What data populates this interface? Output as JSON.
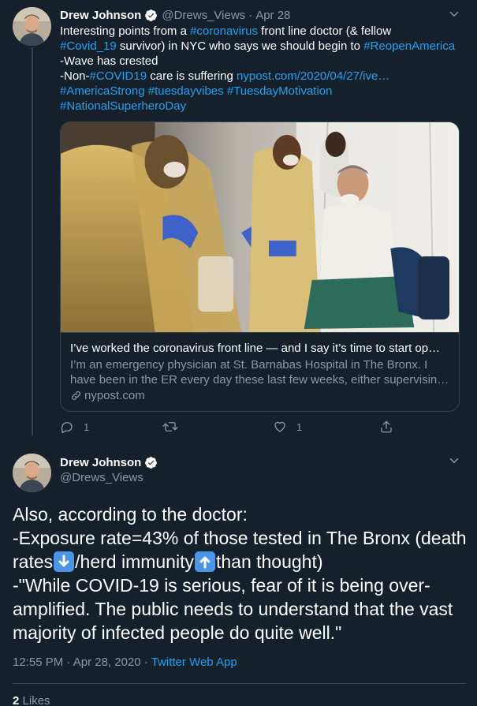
{
  "colors": {
    "background": "#15202b",
    "link": "#1da1f2",
    "muted": "#8899a6",
    "border": "#38444d",
    "emoji_blue": "#4a95e6"
  },
  "tweet1": {
    "author_name": "Drew Johnson",
    "handle": "@Drews_Views",
    "separator": "·",
    "date": "Apr 28",
    "verified_icon": "verified-badge-icon",
    "lines": [
      [
        {
          "text": "Interesting points from a ",
          "link": false
        },
        {
          "text": "#coronavirus",
          "link": true
        },
        {
          "text": " front line doctor (& fellow",
          "link": false
        }
      ],
      [
        {
          "text": "#Covid_19",
          "link": true
        },
        {
          "text": " survivor) in NYC who says we should begin to ",
          "link": false
        },
        {
          "text": "#ReopenAmerica",
          "link": true
        }
      ],
      [
        {
          "text": "-Wave has crested",
          "link": false
        }
      ],
      [
        {
          "text": "-Non-",
          "link": false
        },
        {
          "text": "#COVID19",
          "link": true
        },
        {
          "text": " care is suffering ",
          "link": false
        },
        {
          "text": "nypost.com/2020/04/27/ive…",
          "link": true
        }
      ],
      [
        {
          "text": "#AmericaStrong",
          "link": true
        },
        {
          "text": " ",
          "link": false
        },
        {
          "text": "#tuesdayvibes",
          "link": true
        },
        {
          "text": " ",
          "link": false
        },
        {
          "text": "#TuesdayMotivation",
          "link": true
        }
      ],
      [
        {
          "text": "#NationalSuperheroDay",
          "link": true
        }
      ]
    ],
    "card": {
      "title": "I’ve worked the coronavirus front line — and I say it’s time to start op…",
      "description_lines": [
        "I’m an emergency physician at St. Barnabas Hospital in The Bronx. I",
        "have been in the ER every day these last few weeks, either supervisin…"
      ],
      "domain": "nypost.com",
      "image_alt": "Medical workers in protective gear at a testing tent"
    },
    "actions": {
      "reply_count": "1",
      "retweet_count": "",
      "like_count": "1"
    }
  },
  "tweet2": {
    "author_name": "Drew Johnson",
    "handle": "@Drews_Views",
    "text_lines": [
      [
        {
          "text": "Also, according to the doctor:"
        }
      ],
      [
        {
          "text": "-Exposure rate=43% of those tested in The Bronx (death"
        }
      ],
      [
        {
          "text": "rates"
        },
        {
          "emoji": "down-arrow-emoji"
        },
        {
          "text": "/herd immunity"
        },
        {
          "emoji": "up-arrow-emoji"
        },
        {
          "text": "than thought)"
        }
      ],
      [
        {
          "text": "-\"While COVID-19 is serious, fear of it is being over-"
        }
      ],
      [
        {
          "text": "amplified. The public needs to understand that the vast"
        }
      ],
      [
        {
          "text": "majority of infected people do quite well.\""
        }
      ]
    ],
    "time": "12:55 PM",
    "separator": "·",
    "date": "Apr 28, 2020",
    "source": "Twitter Web App",
    "likes_count": "2",
    "likes_label": "Likes"
  }
}
